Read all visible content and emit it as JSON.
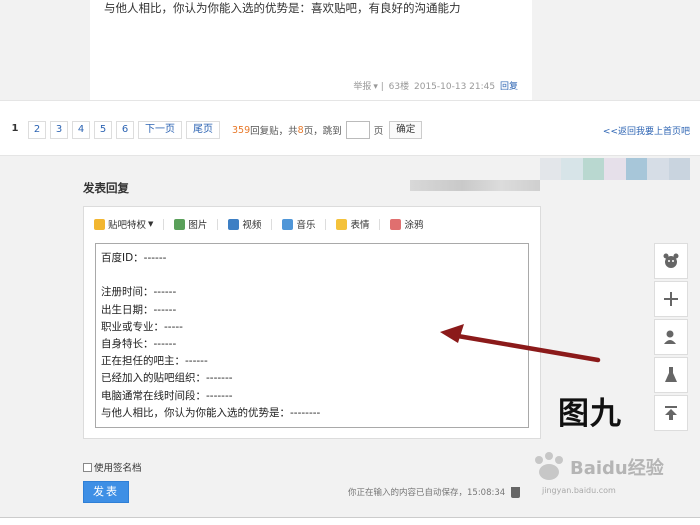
{
  "post": {
    "text": "与他人相比，你认为你能入选的优势是：喜欢贴吧，有良好的沟通能力",
    "report": "举报",
    "floor": "63楼",
    "time": "2015-10-13 21:45",
    "reply": "回复"
  },
  "pager": {
    "pages": [
      "1",
      "2",
      "3",
      "4",
      "5",
      "6"
    ],
    "current": "1",
    "next": "下一页",
    "last": "尾页",
    "reply_count": "359",
    "reply_label": "回复贴，共",
    "page_count": "8",
    "page_label": "页，跳到",
    "page_unit": "页",
    "confirm": "确定",
    "back_link": "<<返回我要上首页吧"
  },
  "reply": {
    "title": "发表回复",
    "toolbar": [
      {
        "label": "贴吧特权",
        "icon": "crown-icon"
      },
      {
        "label": "图片",
        "icon": "picture-icon"
      },
      {
        "label": "视频",
        "icon": "video-icon"
      },
      {
        "label": "音乐",
        "icon": "music-icon"
      },
      {
        "label": "表情",
        "icon": "emoji-icon"
      },
      {
        "label": "涂鸦",
        "icon": "paint-icon"
      }
    ],
    "lines": [
      "百度ID：------",
      "",
      "注册时间：------",
      "出生日期：------",
      "职业或专业：-----",
      "自身特长：------",
      "正在担任的吧主：------",
      "已经加入的贴吧组织：-------",
      "电脑通常在线时间段：-------",
      "与他人相比，你认为你能入选的优势是：--------"
    ],
    "signature": "使用签名档",
    "submit": "发表",
    "autosave": "你正在输入的内容已自动保存，15:08:34"
  },
  "side_bar": [
    "bear-icon",
    "plus-icon",
    "user-icon",
    "flask-icon",
    "top-icon"
  ],
  "annotation": {
    "label": "图九",
    "color": "#8b1a1a"
  },
  "watermark": {
    "brand": "Baidu经验",
    "url": "jingyan.baidu.com"
  }
}
